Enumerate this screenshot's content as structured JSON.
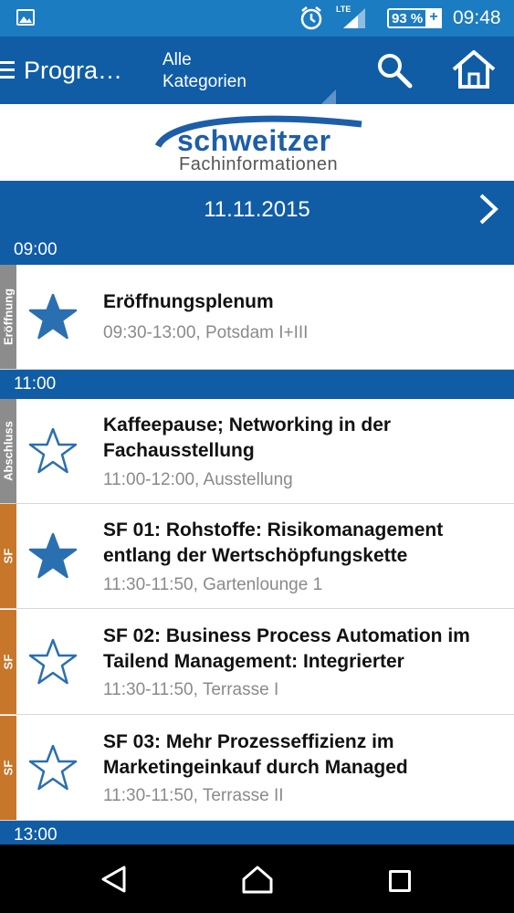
{
  "status_bar": {
    "lte": "LTE",
    "battery": "93 %",
    "battery_plus": "+",
    "time": "09:48",
    "icons": [
      "gallery-icon",
      "alarm-icon",
      "signal-icon",
      "battery-icon"
    ]
  },
  "app_bar": {
    "title": "Progra…",
    "category_line1": "Alle",
    "category_line2": "Kategorien",
    "icons": [
      "menu-icon",
      "search-icon",
      "home-icon"
    ]
  },
  "logo": {
    "brand": "schweitzer",
    "sub": "Fachinformationen"
  },
  "date_bar": {
    "date": "11.11.2015",
    "icon": "chevron-right-icon"
  },
  "time_headers": [
    "09:00",
    "11:00",
    "13:00"
  ],
  "sessions": [
    {
      "tag": "Eröffnung",
      "tag_color": "#8c8c8c",
      "starred": true,
      "title": "Eröffnungsplenum",
      "subtitle": "09:30-13:00, Potsdam I+III"
    },
    {
      "tag": "Abschluss",
      "tag_color": "#8c8c8c",
      "starred": false,
      "title": "Kaffeepause; Networking in der Fachausstellung",
      "subtitle": "11:00-12:00, Ausstellung"
    },
    {
      "tag": "SF",
      "tag_color": "#c8762a",
      "starred": true,
      "title": "SF 01: Rohstoffe: Risikomanagement entlang der Wertschöpfungskette",
      "subtitle": "11:30-11:50, Gartenlounge 1"
    },
    {
      "tag": "SF",
      "tag_color": "#c8762a",
      "starred": false,
      "title": "SF 02: Business Process Automation im Tailend Management: Integrierter",
      "subtitle": "11:30-11:50, Terrasse I"
    },
    {
      "tag": "SF",
      "tag_color": "#c8762a",
      "starred": false,
      "title": "SF 03: Mehr Prozesseffizienz im Marketingeinkauf durch Managed",
      "subtitle": "11:30-11:50, Terrasse II"
    }
  ],
  "colors": {
    "status_bar": "#1b7cc1",
    "primary": "#105da6",
    "star": "#2a6fb0",
    "grey_tag": "#8c8c8c",
    "sf_tag": "#c8762a"
  },
  "nav_bar": {
    "icons": [
      "back-icon",
      "home-nav-icon",
      "recent-apps-icon"
    ]
  }
}
